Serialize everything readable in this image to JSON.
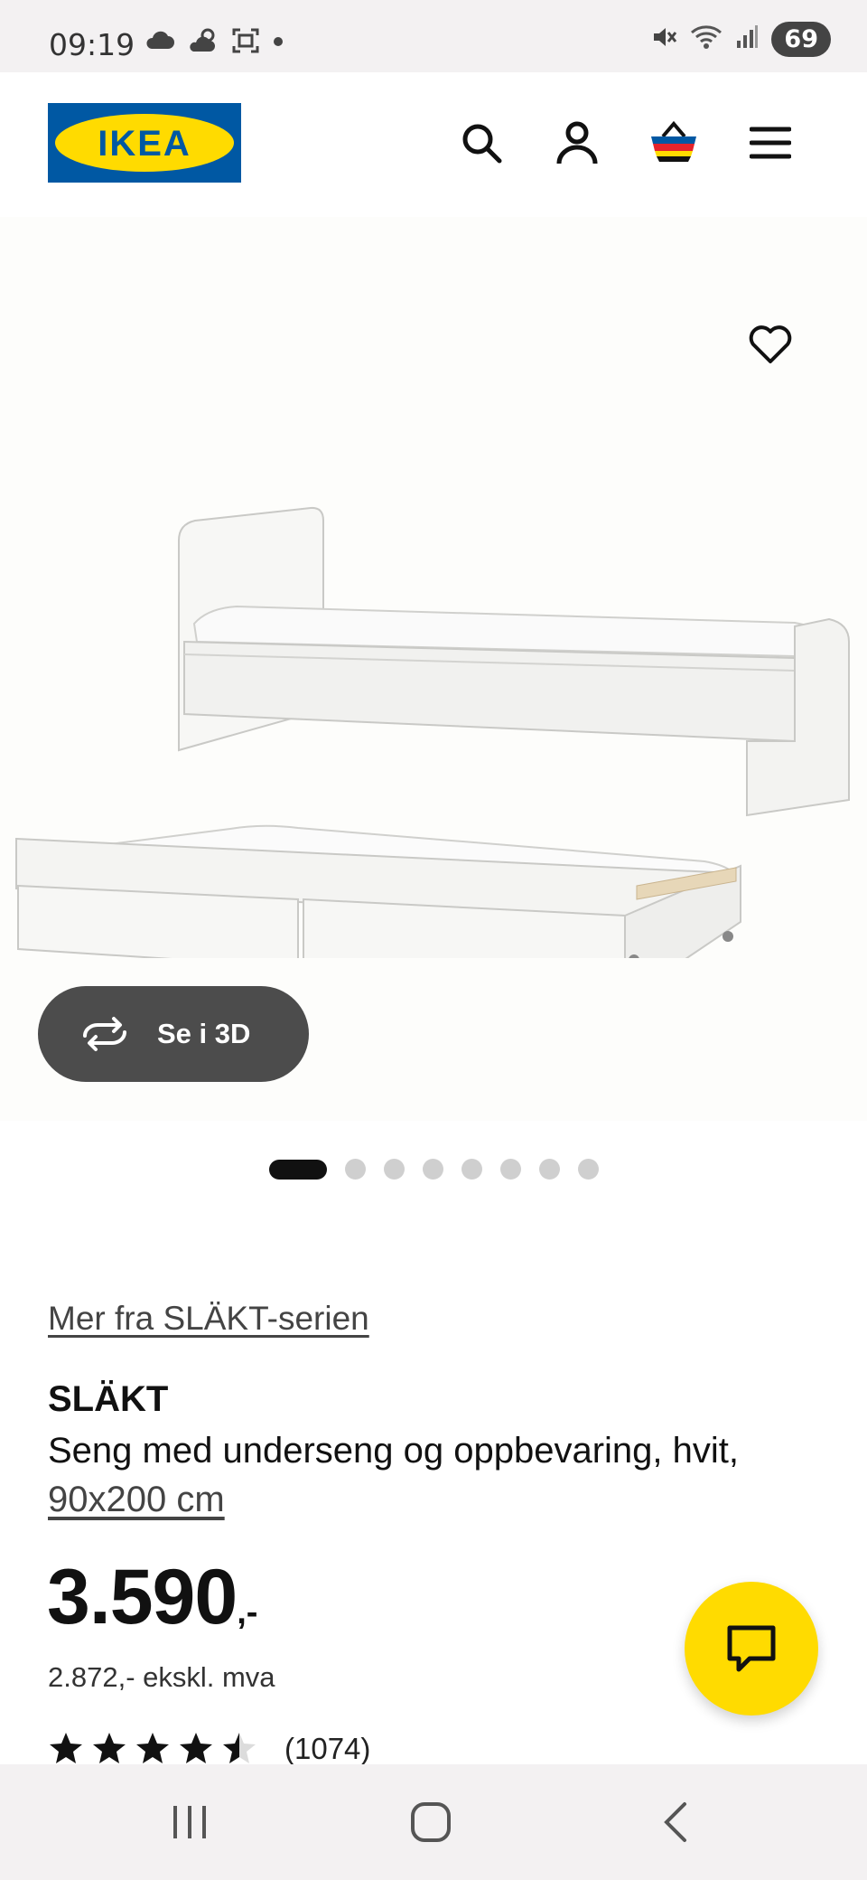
{
  "status_bar": {
    "time": "09:19",
    "battery": "69",
    "icons_left": [
      "cloud-icon",
      "weather-icon",
      "screenshot-icon",
      "dot-icon"
    ],
    "icons_right": [
      "mute-icon",
      "wifi-icon",
      "signal-icon",
      "battery-icon"
    ]
  },
  "header": {
    "logo_text": "IKEA",
    "icons": [
      "search-icon",
      "account-icon",
      "cart-icon",
      "menu-icon"
    ]
  },
  "media": {
    "view3d_label": "Se i 3D",
    "slides_total": 8,
    "active_slide": 1
  },
  "product": {
    "series_link": "Mer fra SLÄKT-serien",
    "name": "SLÄKT",
    "description": "Seng med underseng og oppbevaring, hvit,",
    "size_link": "90x200 cm",
    "price_main": "3.590",
    "price_suffix": ",-",
    "price_ex_vat": "2.872,- ekskl. mva",
    "rating_stars": 4.5,
    "rating_count": "(1074)"
  },
  "colors": {
    "ikea_blue": "#0058a3",
    "ikea_yellow": "#ffdb00",
    "button_dark": "#4c4c4c"
  }
}
